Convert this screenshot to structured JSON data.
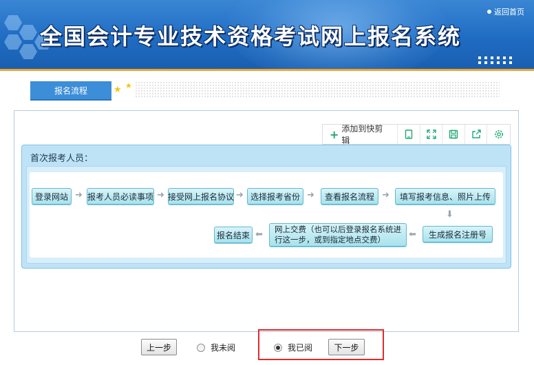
{
  "header": {
    "title": "全国会计专业技术资格考试网上报名系统",
    "return_link": "返回首页"
  },
  "tab": {
    "label": "报名流程"
  },
  "toolbar": {
    "add_label": "添加到快剪辑",
    "icons": [
      "tablet-icon",
      "expand-icon",
      "save-icon",
      "share-icon",
      "settings-icon"
    ]
  },
  "flow": {
    "heading": "首次报考人员：",
    "steps": [
      "登录网站",
      "报考人员必读事项",
      "接受网上报名协议",
      "选择报考省份",
      "查看报名流程",
      "填写报考信息、照片上传",
      "生成报名注册号",
      "网上交费（也可以后登录报名系统进行这一步，或到指定地点交费）",
      "报名结束"
    ],
    "step8_lines": [
      "网上交费（也可以后登录报名系统进",
      "行这一步，或到指定地点交费）"
    ]
  },
  "footer": {
    "prev_label": "上一步",
    "unread_label": "我未阅",
    "read_label": "我已阅",
    "next_label": "下一步",
    "selected": "我已阅"
  },
  "colors": {
    "banner": "#1f6cc3",
    "accent_line": "#f2a42c",
    "tab": "#3c8ed8",
    "step_fill": "#a9e2ec",
    "highlight_border": "#e02b2b"
  }
}
